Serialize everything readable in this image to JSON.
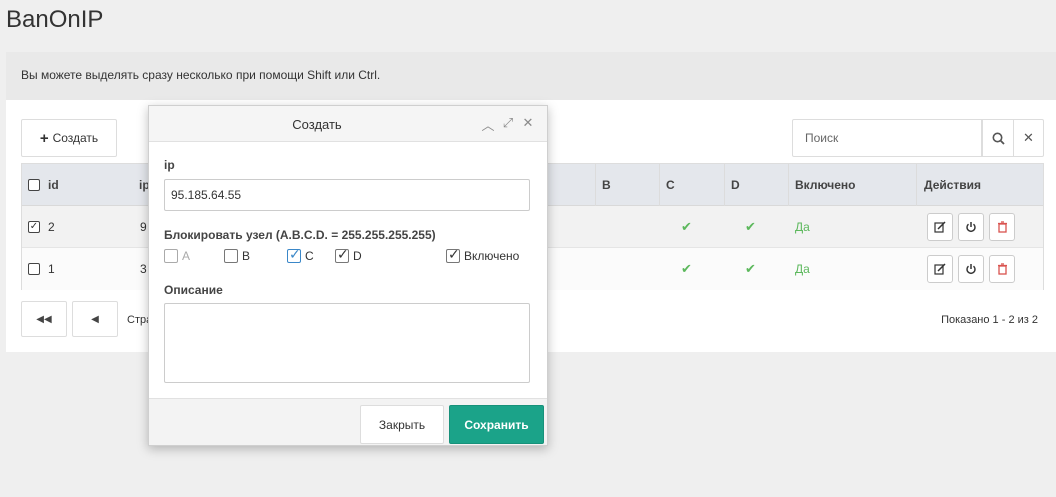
{
  "app": {
    "title": "BanOnIP"
  },
  "hint": "Вы можете выделять сразу несколько при помощи Shift или Ctrl.",
  "toolbar": {
    "create_label": "Создать",
    "search_placeholder": "Поиск"
  },
  "grid": {
    "columns": {
      "id": "id",
      "ip": "ip",
      "b": "B",
      "c": "C",
      "d": "D",
      "enabled": "Включено",
      "actions": "Действия"
    },
    "rows": [
      {
        "checked": true,
        "id": "2",
        "ip_partial": "9",
        "c": true,
        "d": true,
        "enabled": "Да"
      },
      {
        "checked": false,
        "id": "1",
        "ip_partial": "3",
        "c": true,
        "d": true,
        "enabled": "Да"
      }
    ]
  },
  "pager": {
    "label_partial": "Стра",
    "shown": "Показано 1 - 2 из 2"
  },
  "modal": {
    "title": "Создать",
    "ip_label": "ip",
    "ip_value": "95.185.64.55",
    "block_label": "Блокировать узел (A.B.C.D. = 255.255.255.255)",
    "options": [
      {
        "label": "A",
        "checked": false
      },
      {
        "label": "B",
        "checked": false
      },
      {
        "label": "C",
        "checked": true
      },
      {
        "label": "D",
        "checked": true
      }
    ],
    "enabled_label": "Включено",
    "enabled_checked": true,
    "desc_label": "Описание",
    "close_label": "Закрыть",
    "save_label": "Сохранить"
  },
  "colors": {
    "accent": "#1ba389",
    "success": "#5cb85c",
    "checkbox_blue": "#3a87c8",
    "danger": "#d9534f"
  },
  "icons": [
    "plus-icon",
    "search-icon",
    "close-icon",
    "checkmark-icon",
    "edit-icon",
    "power-icon",
    "trash-icon",
    "first-page-icon",
    "prev-page-icon",
    "collapse-icon",
    "expand-icon"
  ]
}
